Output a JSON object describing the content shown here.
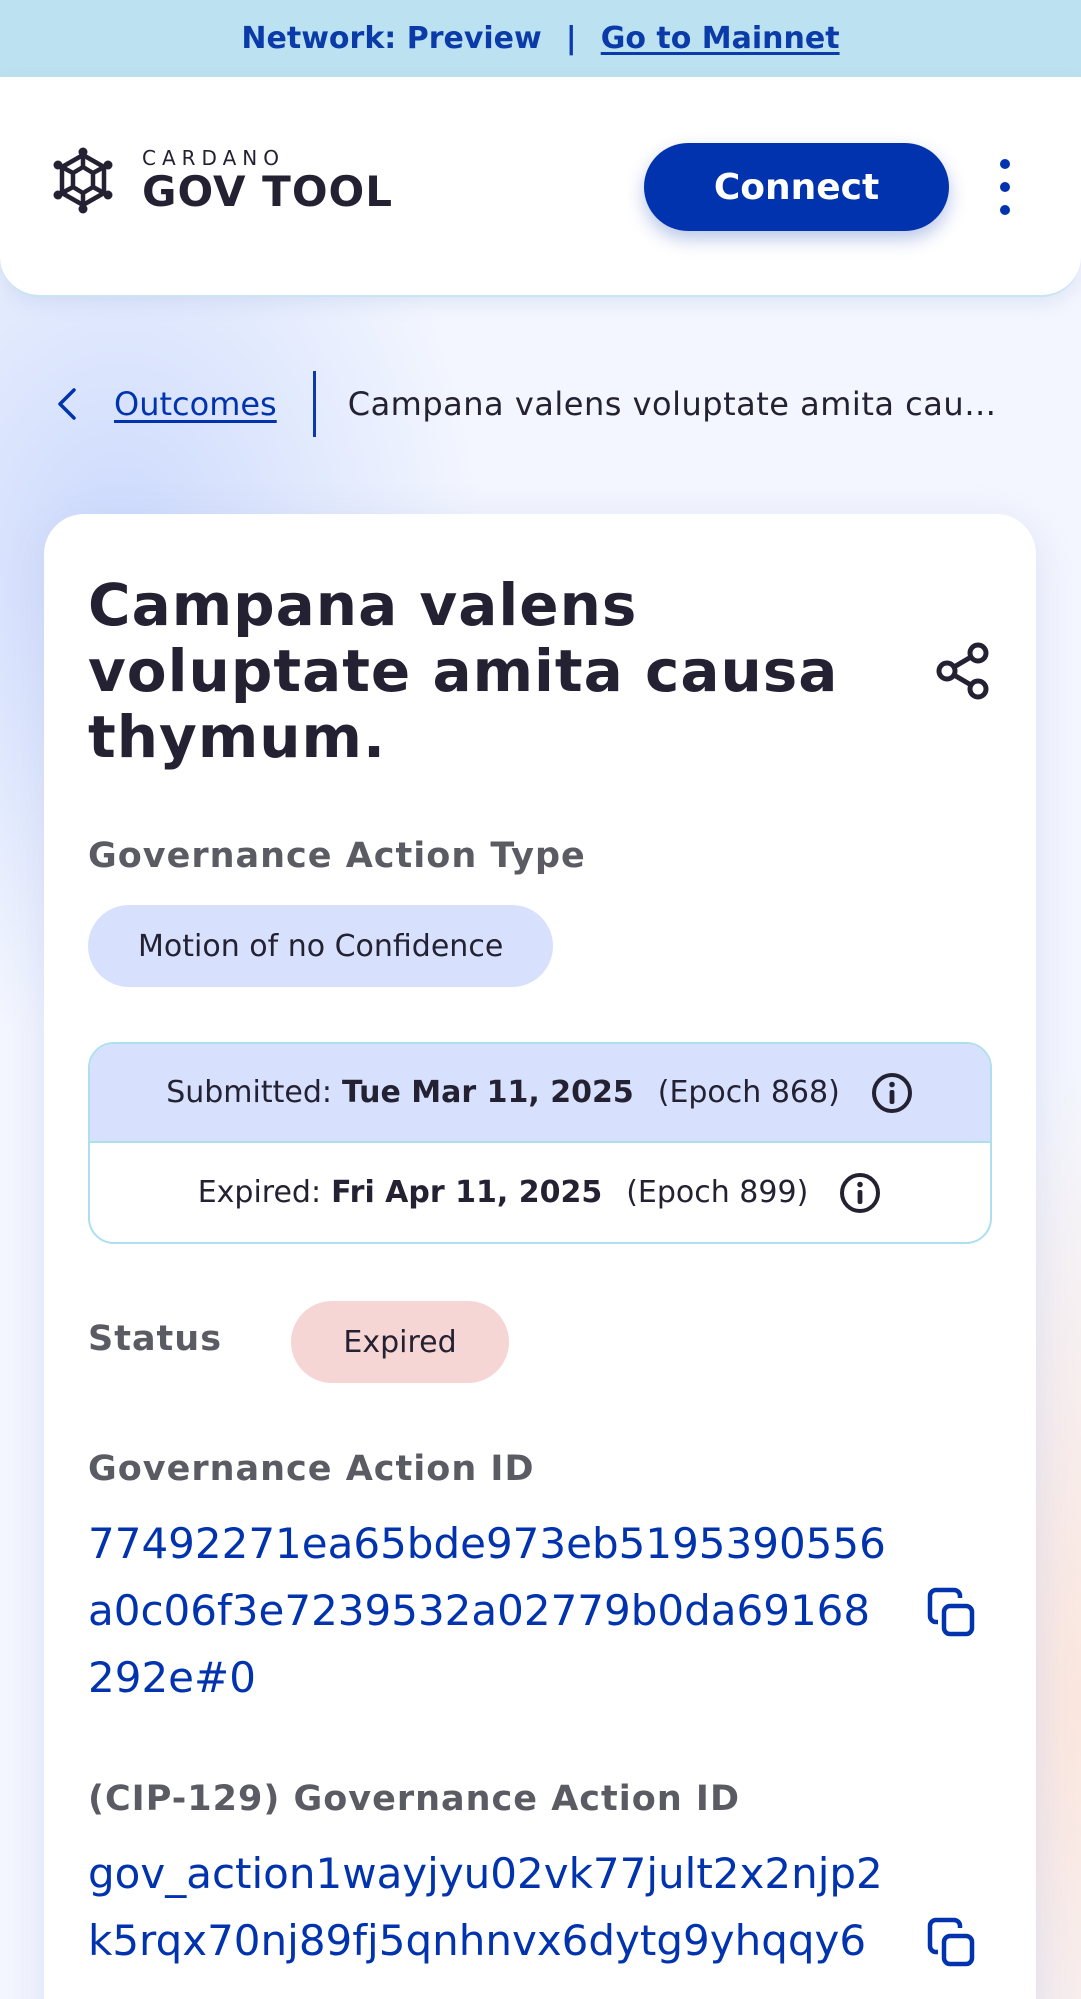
{
  "network_bar": {
    "network_label": "Network: Preview",
    "separator": "|",
    "switch_link": "Go to Mainnet"
  },
  "header": {
    "logo_small": "CARDANO",
    "logo_big": "GOV TOOL",
    "connect_label": "Connect",
    "menu_icon": "kebab-menu-icon"
  },
  "breadcrumb": {
    "back_icon": "chevron-left-icon",
    "parent_label": "Outcomes",
    "current_label": "Campana valens voluptate amita causa thymum."
  },
  "action": {
    "title": "Campana valens voluptate amita causa thymum.",
    "share_icon": "share-icon",
    "type_label": "Governance Action Type",
    "type_value": "Motion of no Confidence",
    "submitted_label": "Submitted:",
    "submitted_date": "Tue Mar 11, 2025",
    "submitted_epoch": "(Epoch 868)",
    "expired_label": "Expired:",
    "expired_date": "Fri Apr 11, 2025",
    "expired_epoch": "(Epoch 899)",
    "info_icon": "info-icon",
    "status_label": "Status",
    "status_value": "Expired",
    "id_label": "Governance Action ID",
    "id_value": "77492271ea65bde973eb5195390556a0c06f3e7239532a02779b0da69168292e#0",
    "cip129_label": "(CIP-129) Governance Action ID",
    "cip129_value": "gov_action1wayjyu02vk77jult2x2njp2k5rqx70nj89fj5qnhnvx6dytg9yhqqy6",
    "copy_icon": "copy-icon"
  },
  "colors": {
    "brand_blue": "#0033ad",
    "network_bar_bg": "#bce2f1",
    "type_chip_bg": "#d7e1fe",
    "status_expired_bg": "#f6d5d5"
  }
}
